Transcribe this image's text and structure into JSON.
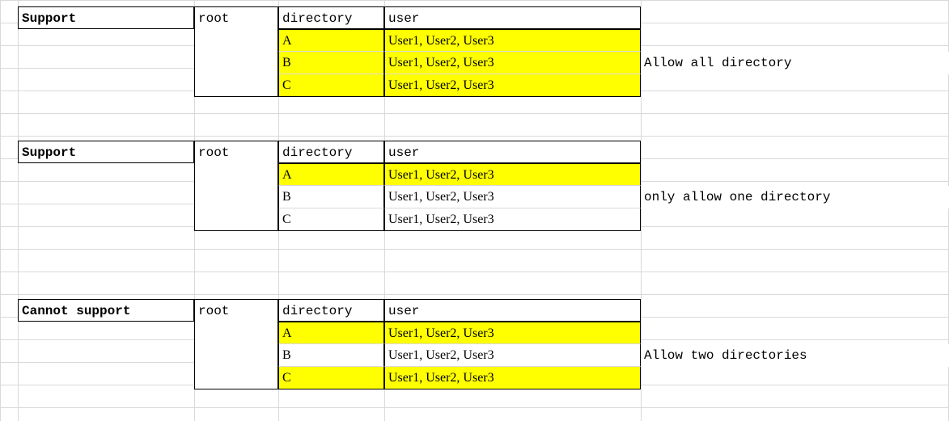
{
  "blocks": [
    {
      "id": "block1",
      "label": "Support",
      "root": "root",
      "headers": {
        "dir": "directory",
        "user": "user"
      },
      "rows": [
        {
          "dir": "A",
          "user": "User1, User2, User3",
          "dir_hl": true,
          "user_hl": true
        },
        {
          "dir": "B",
          "user": "User1, User2, User3",
          "dir_hl": true,
          "user_hl": true
        },
        {
          "dir": "C",
          "user": "User1, User2, User3",
          "dir_hl": true,
          "user_hl": true
        }
      ],
      "note": "Allow all directory"
    },
    {
      "id": "block2",
      "label": "Support",
      "root": "root",
      "headers": {
        "dir": "directory",
        "user": "user"
      },
      "rows": [
        {
          "dir": "A",
          "user": "User1, User2, User3",
          "dir_hl": true,
          "user_hl": true
        },
        {
          "dir": "B",
          "user": "User1, User2, User3",
          "dir_hl": false,
          "user_hl": false
        },
        {
          "dir": "C",
          "user": "User1, User2, User3",
          "dir_hl": false,
          "user_hl": false
        }
      ],
      "note": "only allow one directory"
    },
    {
      "id": "block3",
      "label": "Cannot support",
      "root": "root",
      "headers": {
        "dir": "directory",
        "user": "user"
      },
      "rows": [
        {
          "dir": "A",
          "user": "User1, User2, User3",
          "dir_hl": true,
          "user_hl": true
        },
        {
          "dir": "B",
          "user": "User1, User2, User3",
          "dir_hl": false,
          "user_hl": false
        },
        {
          "dir": "C",
          "user": "User1, User2, User3",
          "dir_hl": true,
          "user_hl": true
        }
      ],
      "note": "Allow two directories"
    }
  ],
  "colors": {
    "highlight": "#ffff00",
    "gridline": "#d9d9d9",
    "border": "#000000"
  }
}
